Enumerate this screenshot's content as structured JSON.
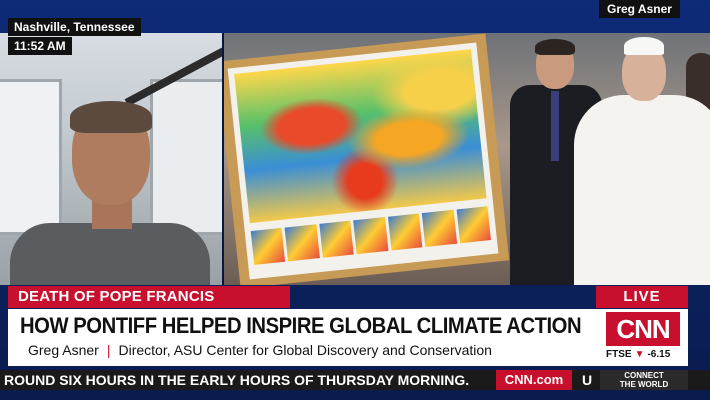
{
  "top": {
    "location": "Nashville, Tennessee",
    "time": "11:52 AM",
    "guest_name": "Greg Asner"
  },
  "lower_third": {
    "kicker": "DEATH OF POPE FRANCIS",
    "live": "LIVE",
    "headline": "HOW PONTIFF HELPED INSPIRE GLOBAL CLIMATE ACTION",
    "speaker_name": "Greg Asner",
    "separator": "|",
    "speaker_title": "Director, ASU Center for Global Discovery and Conservation"
  },
  "network": {
    "logo": "CNN",
    "ftse_label": "FTSE",
    "ftse_change": "-6.15",
    "ftse_arrow": "▼"
  },
  "ticker": {
    "text": "ROUND SIX HOURS IN THE EARLY HOURS OF THURSDAY MORNING.",
    "site": "CNN.com",
    "tail": "U",
    "connect_line1": "CONNECT",
    "connect_line2": "THE WORLD"
  },
  "colors": {
    "brand_red": "#c8102e",
    "bar_dark": "#1a1a1a"
  }
}
